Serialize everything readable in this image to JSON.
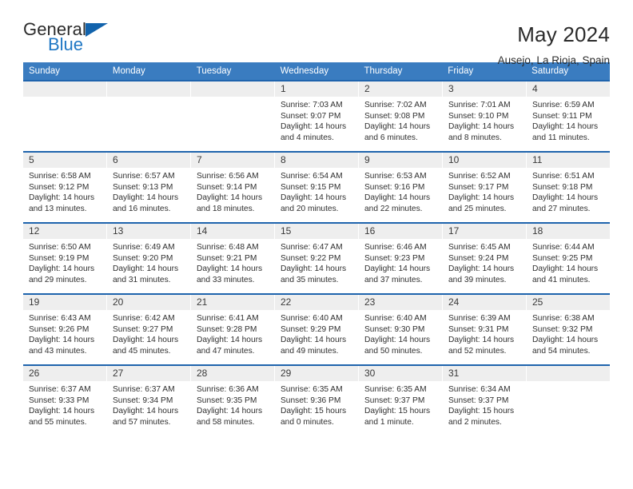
{
  "brand": {
    "name_top": "General",
    "name_bottom": "Blue",
    "accent_color": "#1f77c4",
    "triangle_color": "#1263ac"
  },
  "header": {
    "title": "May 2024",
    "location": "Ausejo, La Rioja, Spain"
  },
  "theme": {
    "header_row_bg": "#3a7cc0",
    "week_divider": "#1f64ad",
    "daynum_band_bg": "#eeeeee"
  },
  "weekdays": [
    "Sunday",
    "Monday",
    "Tuesday",
    "Wednesday",
    "Thursday",
    "Friday",
    "Saturday"
  ],
  "labels": {
    "sunrise": "Sunrise:",
    "sunset": "Sunset:",
    "daylight": "Daylight:"
  },
  "weeks": [
    [
      {
        "day": "",
        "sunrise": "",
        "sunset": "",
        "daylight": "",
        "empty": true
      },
      {
        "day": "",
        "sunrise": "",
        "sunset": "",
        "daylight": "",
        "empty": true
      },
      {
        "day": "",
        "sunrise": "",
        "sunset": "",
        "daylight": "",
        "empty": true
      },
      {
        "day": "1",
        "sunrise": "Sunrise: 7:03 AM",
        "sunset": "Sunset: 9:07 PM",
        "daylight": "Daylight: 14 hours and 4 minutes."
      },
      {
        "day": "2",
        "sunrise": "Sunrise: 7:02 AM",
        "sunset": "Sunset: 9:08 PM",
        "daylight": "Daylight: 14 hours and 6 minutes."
      },
      {
        "day": "3",
        "sunrise": "Sunrise: 7:01 AM",
        "sunset": "Sunset: 9:10 PM",
        "daylight": "Daylight: 14 hours and 8 minutes."
      },
      {
        "day": "4",
        "sunrise": "Sunrise: 6:59 AM",
        "sunset": "Sunset: 9:11 PM",
        "daylight": "Daylight: 14 hours and 11 minutes."
      }
    ],
    [
      {
        "day": "5",
        "sunrise": "Sunrise: 6:58 AM",
        "sunset": "Sunset: 9:12 PM",
        "daylight": "Daylight: 14 hours and 13 minutes."
      },
      {
        "day": "6",
        "sunrise": "Sunrise: 6:57 AM",
        "sunset": "Sunset: 9:13 PM",
        "daylight": "Daylight: 14 hours and 16 minutes."
      },
      {
        "day": "7",
        "sunrise": "Sunrise: 6:56 AM",
        "sunset": "Sunset: 9:14 PM",
        "daylight": "Daylight: 14 hours and 18 minutes."
      },
      {
        "day": "8",
        "sunrise": "Sunrise: 6:54 AM",
        "sunset": "Sunset: 9:15 PM",
        "daylight": "Daylight: 14 hours and 20 minutes."
      },
      {
        "day": "9",
        "sunrise": "Sunrise: 6:53 AM",
        "sunset": "Sunset: 9:16 PM",
        "daylight": "Daylight: 14 hours and 22 minutes."
      },
      {
        "day": "10",
        "sunrise": "Sunrise: 6:52 AM",
        "sunset": "Sunset: 9:17 PM",
        "daylight": "Daylight: 14 hours and 25 minutes."
      },
      {
        "day": "11",
        "sunrise": "Sunrise: 6:51 AM",
        "sunset": "Sunset: 9:18 PM",
        "daylight": "Daylight: 14 hours and 27 minutes."
      }
    ],
    [
      {
        "day": "12",
        "sunrise": "Sunrise: 6:50 AM",
        "sunset": "Sunset: 9:19 PM",
        "daylight": "Daylight: 14 hours and 29 minutes."
      },
      {
        "day": "13",
        "sunrise": "Sunrise: 6:49 AM",
        "sunset": "Sunset: 9:20 PM",
        "daylight": "Daylight: 14 hours and 31 minutes."
      },
      {
        "day": "14",
        "sunrise": "Sunrise: 6:48 AM",
        "sunset": "Sunset: 9:21 PM",
        "daylight": "Daylight: 14 hours and 33 minutes."
      },
      {
        "day": "15",
        "sunrise": "Sunrise: 6:47 AM",
        "sunset": "Sunset: 9:22 PM",
        "daylight": "Daylight: 14 hours and 35 minutes."
      },
      {
        "day": "16",
        "sunrise": "Sunrise: 6:46 AM",
        "sunset": "Sunset: 9:23 PM",
        "daylight": "Daylight: 14 hours and 37 minutes."
      },
      {
        "day": "17",
        "sunrise": "Sunrise: 6:45 AM",
        "sunset": "Sunset: 9:24 PM",
        "daylight": "Daylight: 14 hours and 39 minutes."
      },
      {
        "day": "18",
        "sunrise": "Sunrise: 6:44 AM",
        "sunset": "Sunset: 9:25 PM",
        "daylight": "Daylight: 14 hours and 41 minutes."
      }
    ],
    [
      {
        "day": "19",
        "sunrise": "Sunrise: 6:43 AM",
        "sunset": "Sunset: 9:26 PM",
        "daylight": "Daylight: 14 hours and 43 minutes."
      },
      {
        "day": "20",
        "sunrise": "Sunrise: 6:42 AM",
        "sunset": "Sunset: 9:27 PM",
        "daylight": "Daylight: 14 hours and 45 minutes."
      },
      {
        "day": "21",
        "sunrise": "Sunrise: 6:41 AM",
        "sunset": "Sunset: 9:28 PM",
        "daylight": "Daylight: 14 hours and 47 minutes."
      },
      {
        "day": "22",
        "sunrise": "Sunrise: 6:40 AM",
        "sunset": "Sunset: 9:29 PM",
        "daylight": "Daylight: 14 hours and 49 minutes."
      },
      {
        "day": "23",
        "sunrise": "Sunrise: 6:40 AM",
        "sunset": "Sunset: 9:30 PM",
        "daylight": "Daylight: 14 hours and 50 minutes."
      },
      {
        "day": "24",
        "sunrise": "Sunrise: 6:39 AM",
        "sunset": "Sunset: 9:31 PM",
        "daylight": "Daylight: 14 hours and 52 minutes."
      },
      {
        "day": "25",
        "sunrise": "Sunrise: 6:38 AM",
        "sunset": "Sunset: 9:32 PM",
        "daylight": "Daylight: 14 hours and 54 minutes."
      }
    ],
    [
      {
        "day": "26",
        "sunrise": "Sunrise: 6:37 AM",
        "sunset": "Sunset: 9:33 PM",
        "daylight": "Daylight: 14 hours and 55 minutes."
      },
      {
        "day": "27",
        "sunrise": "Sunrise: 6:37 AM",
        "sunset": "Sunset: 9:34 PM",
        "daylight": "Daylight: 14 hours and 57 minutes."
      },
      {
        "day": "28",
        "sunrise": "Sunrise: 6:36 AM",
        "sunset": "Sunset: 9:35 PM",
        "daylight": "Daylight: 14 hours and 58 minutes."
      },
      {
        "day": "29",
        "sunrise": "Sunrise: 6:35 AM",
        "sunset": "Sunset: 9:36 PM",
        "daylight": "Daylight: 15 hours and 0 minutes."
      },
      {
        "day": "30",
        "sunrise": "Sunrise: 6:35 AM",
        "sunset": "Sunset: 9:37 PM",
        "daylight": "Daylight: 15 hours and 1 minute."
      },
      {
        "day": "31",
        "sunrise": "Sunrise: 6:34 AM",
        "sunset": "Sunset: 9:37 PM",
        "daylight": "Daylight: 15 hours and 2 minutes."
      },
      {
        "day": "",
        "sunrise": "",
        "sunset": "",
        "daylight": "",
        "empty": true
      }
    ]
  ]
}
